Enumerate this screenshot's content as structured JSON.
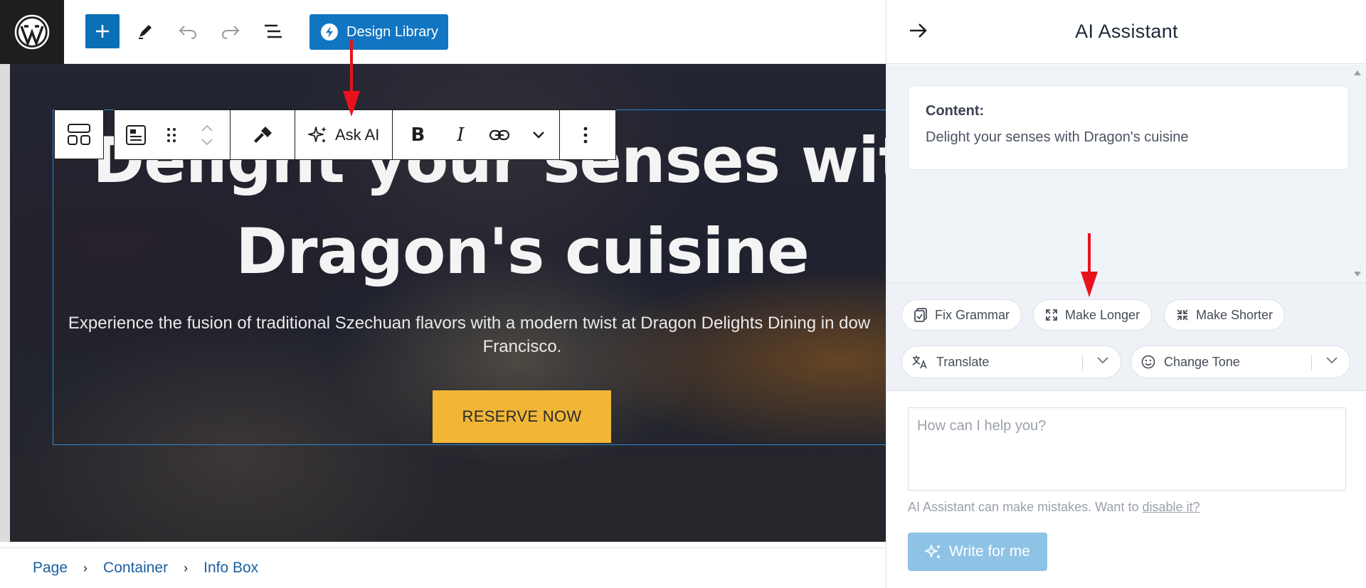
{
  "header": {
    "design_library_label": "Design Library"
  },
  "block_toolbar": {
    "ask_ai_label": "Ask AI"
  },
  "hero": {
    "title_line1": "Delight your senses with",
    "title_line2": "Dragon's cuisine",
    "subtitle_line1": "Experience the fusion of traditional Szechuan flavors with a modern twist at Dragon Delights Dining in dow",
    "subtitle_line2": "Francisco.",
    "button_label": "RESERVE NOW"
  },
  "breadcrumb": {
    "items": [
      "Page",
      "Container",
      "Info Box"
    ]
  },
  "panel": {
    "title": "AI Assistant",
    "content_label": "Content:",
    "content_text": "Delight your senses with Dragon's cuisine",
    "actions": {
      "fix_grammar": "Fix Grammar",
      "make_longer": "Make Longer",
      "make_shorter": "Make Shorter",
      "translate": "Translate",
      "change_tone": "Change Tone"
    },
    "prompt_placeholder": "How can I help you?",
    "disclaimer_text": "AI Assistant can make mistakes. Want to",
    "disclaimer_link": "disable it?",
    "write_button": "Write for me"
  },
  "colors": {
    "wp_blue": "#0a6fb5",
    "design_library_blue": "#1175c2",
    "reserve_yellow": "#f2b637",
    "write_button_blue": "#8ec3e6",
    "arrow_red": "#e8121c"
  }
}
